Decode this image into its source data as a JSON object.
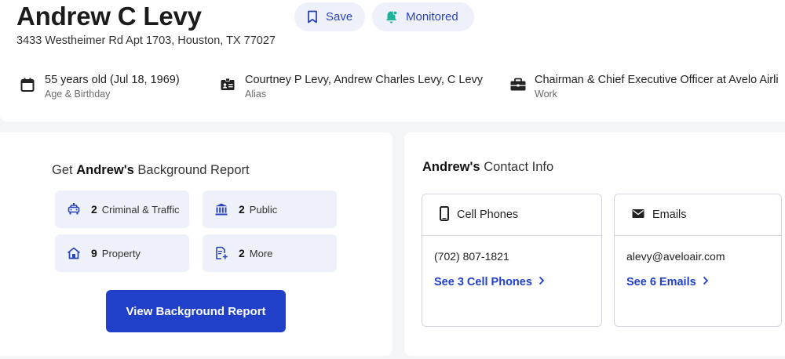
{
  "header": {
    "name": "Andrew C Levy",
    "address": "3433 Westheimer Rd Apt 1703, Houston, TX 77027",
    "save_label": "Save",
    "monitored_label": "Monitored"
  },
  "info": {
    "age": {
      "value": "55 years old (Jul 18, 1969)",
      "label": "Age & Birthday",
      "icon": "calendar-icon"
    },
    "alias": {
      "value": "Courtney P Levy, Andrew Charles Levy, C Levy",
      "label": "Alias",
      "icon": "id-card-icon"
    },
    "work": {
      "value": "Chairman & Chief Executive Officer at Avelo Airli",
      "label": "Work",
      "icon": "briefcase-icon"
    }
  },
  "background": {
    "title_prefix": "Get",
    "title_name": "Andrew's",
    "title_suffix": "Background Report",
    "tiles": [
      {
        "count": "2",
        "label": "Criminal & Traffic",
        "icon": "police-car-icon"
      },
      {
        "count": "2",
        "label": "Public",
        "icon": "courthouse-icon"
      },
      {
        "count": "9",
        "label": "Property",
        "icon": "house-icon"
      },
      {
        "count": "2",
        "label": "More",
        "icon": "document-plus-icon"
      }
    ],
    "cta_label": "View Background Report"
  },
  "contact": {
    "title_name": "Andrew's",
    "title_suffix": "Contact Info",
    "phones": {
      "heading": "Cell Phones",
      "value": "(702) 807-1821",
      "more_label": "See 3 Cell Phones"
    },
    "emails": {
      "heading": "Emails",
      "value": "alevy@aveloair.com",
      "more_label": "See 6 Emails"
    }
  },
  "colors": {
    "accent": "#2140c9",
    "pill_bg": "#eef1fa",
    "monitored_icon": "#1fb39a"
  }
}
